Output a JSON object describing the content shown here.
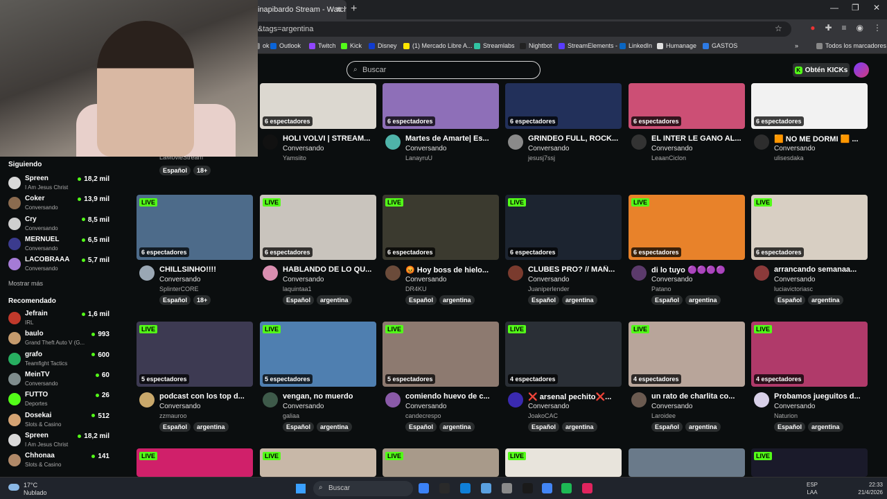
{
  "browser": {
    "tab_title": "inapibardo Stream - Watch Li",
    "tab_close": "✕",
    "new_tab": "+",
    "address": "&tags=argentina",
    "window_controls": [
      "—",
      "❐",
      "✕"
    ],
    "bookmarks": [
      {
        "label": "ok",
        "color": "#888888"
      },
      {
        "label": "Outlook",
        "color": "#0a64d8"
      },
      {
        "label": "Twitch",
        "color": "#9146ff"
      },
      {
        "label": "Kick",
        "color": "#53fc18"
      },
      {
        "label": "Disney",
        "color": "#113ccf"
      },
      {
        "label": "(1) Mercado Libre A...",
        "color": "#ffe600"
      },
      {
        "label": "Streamlabs",
        "color": "#31c3a2"
      },
      {
        "label": "Nightbot",
        "color": "#222222"
      },
      {
        "label": "StreamElements -",
        "color": "#5a3cff"
      },
      {
        "label": "LinkedIn",
        "color": "#0a66c2"
      },
      {
        "label": "Humanage",
        "color": "#e0e0e0"
      },
      {
        "label": "GASTOS",
        "color": "#2d7be5"
      },
      {
        "label": "»",
        "color": ""
      },
      {
        "label": "Todos los marcadores",
        "color": "#888888"
      }
    ]
  },
  "header": {
    "search_placeholder": "Buscar",
    "cta_label": "Obtén KICKs"
  },
  "sidebar": {
    "following_title": "Siguiendo",
    "following": [
      {
        "name": "Spreen",
        "sub": "I Am Jesus Christ",
        "count": "18,2 mil",
        "color": "#d9d9d9"
      },
      {
        "name": "Coker",
        "sub": "Conversando",
        "count": "13,9 mil",
        "color": "#8b6b4f"
      },
      {
        "name": "Cry",
        "sub": "Conversando",
        "count": "8,5 mil",
        "color": "#cfcfcf"
      },
      {
        "name": "MERNUEL",
        "sub": "Conversando",
        "count": "6,5 mil",
        "color": "#3b3b8e"
      },
      {
        "name": "LACOBRAAA",
        "sub": "Conversando",
        "count": "5,7 mil",
        "color": "#a57bd6"
      }
    ],
    "more_label": "Mostrar más",
    "recommended_title": "Recomendado",
    "recommended": [
      {
        "name": "Jefrain",
        "sub": "IRL",
        "count": "1,6 mil",
        "color": "#c0392b"
      },
      {
        "name": "baulo",
        "sub": "Grand Theft Auto V (G...",
        "count": "993",
        "color": "#c59b6d"
      },
      {
        "name": "grafo",
        "sub": "Teamfight Tactics",
        "count": "600",
        "color": "#27ae60"
      },
      {
        "name": "MeinTV",
        "sub": "Conversando",
        "count": "60",
        "color": "#7f8c8d"
      },
      {
        "name": "FUTTO",
        "sub": "Deportes",
        "count": "26",
        "color": "#53fc18"
      },
      {
        "name": "Dosekai",
        "sub": "Slots & Casino",
        "count": "512",
        "color": "#d4a373"
      },
      {
        "name": "Spreen",
        "sub": "I Am Jesus Christ",
        "count": "18,2 mil",
        "color": "#d9d9d9"
      },
      {
        "name": "Chhonaa",
        "sub": "Slots & Casino",
        "count": "141",
        "color": "#b08968"
      }
    ]
  },
  "cards": [
    {
      "title": "",
      "category": "",
      "user": "LaMovieStream",
      "viewers": "",
      "tags": [
        "Español",
        "18+"
      ],
      "live": "",
      "thumb": "#2b2b2b",
      "avatar": "#555555"
    },
    {
      "title": "HOLI VOLVI | STREAM...",
      "category": "Conversando",
      "user": "Yamsiito",
      "viewers": "6 espectadores",
      "tags": [],
      "live": "",
      "thumb": "#dcd8d0",
      "avatar": "#111111"
    },
    {
      "title": "Martes de Amarte| Es...",
      "category": "Conversando",
      "user": "LanayruU",
      "viewers": "6 espectadores",
      "tags": [],
      "live": "",
      "thumb": "#8e6fb8",
      "avatar": "#4fb3a9"
    },
    {
      "title": "GRINDEO FULL, ROCK...",
      "category": "Conversando",
      "user": "jesusj7ssj",
      "viewers": "6 espectadores",
      "tags": [],
      "live": "",
      "thumb": "#22305a",
      "avatar": "#8a8a8a"
    },
    {
      "title": "EL INTER LE GANO AL...",
      "category": "Conversando",
      "user": "LeaanCiclon",
      "viewers": "6 espectadores",
      "tags": [],
      "live": "",
      "thumb": "#cc4f75",
      "avatar": "#333333"
    },
    {
      "title": "🟧 NO ME DORMI 🟧 ...",
      "category": "Conversando",
      "user": "ulisesdaka",
      "viewers": "6 espectadores",
      "tags": [],
      "live": "",
      "thumb": "#f2f2f2",
      "avatar": "#2d2d2d"
    },
    {
      "title": "CHILLSINHO!!!!",
      "category": "Conversando",
      "user": "SplinterCORE",
      "viewers": "6 espectadores",
      "tags": [
        "Español",
        "18+"
      ],
      "live": "LIVE",
      "thumb": "#4d6b8a",
      "avatar": "#9aa7b4"
    },
    {
      "title": "HABLANDO DE LO QU...",
      "category": "Conversando",
      "user": "laquintaa1",
      "viewers": "6 espectadores",
      "tags": [
        "Español",
        "argentina"
      ],
      "live": "LIVE",
      "thumb": "#c9c4bd",
      "avatar": "#d98eb0"
    },
    {
      "title": "😡 Hoy boss de hielo...",
      "category": "Conversando",
      "user": "DR4KU",
      "viewers": "6 espectadores",
      "tags": [
        "Español",
        "argentina"
      ],
      "live": "LIVE",
      "thumb": "#3b3a2f",
      "avatar": "#6b4b3a"
    },
    {
      "title": "CLUBES PRO? // MAÑ...",
      "category": "Conversando",
      "user": "Juaniperlender",
      "viewers": "6 espectadores",
      "tags": [
        "Español",
        "argentina"
      ],
      "live": "LIVE",
      "thumb": "#1c2430",
      "avatar": "#7a3b2e"
    },
    {
      "title": "di lo tuyo 🟣🟣🟣🟣",
      "category": "Conversando",
      "user": "Patano",
      "viewers": "6 espectadores",
      "tags": [
        "Español",
        "argentina"
      ],
      "live": "LIVE",
      "thumb": "#e8822a",
      "avatar": "#5b3a6b"
    },
    {
      "title": "arrancando semanaa...",
      "category": "Conversando",
      "user": "luciavictoriasc",
      "viewers": "6 espectadores",
      "tags": [
        "Español",
        "argentina"
      ],
      "live": "LIVE",
      "thumb": "#d8cfc3",
      "avatar": "#8b3a3a"
    },
    {
      "title": "podcast con los top d...",
      "category": "Conversando",
      "user": "zzmauroo",
      "viewers": "5 espectadores",
      "tags": [
        "Español",
        "argentina"
      ],
      "live": "LIVE",
      "thumb": "#3d3a52",
      "avatar": "#c9a86b"
    },
    {
      "title": "vengan, no muerdo",
      "category": "Conversando",
      "user": "galiaa",
      "viewers": "5 espectadores",
      "tags": [
        "Español",
        "argentina"
      ],
      "live": "LIVE",
      "thumb": "#4f7fb0",
      "avatar": "#3e5a4a"
    },
    {
      "title": "comiendo huevo de c...",
      "category": "Conversando",
      "user": "candecrespo",
      "viewers": "5 espectadores",
      "tags": [
        "Español",
        "argentina"
      ],
      "live": "LIVE",
      "thumb": "#8d7a70",
      "avatar": "#8a5aa8"
    },
    {
      "title": "❌ arsenal pechito❌...",
      "category": "Conversando",
      "user": "JoakoCAC",
      "viewers": "4 espectadores",
      "tags": [
        "Español",
        "argentina"
      ],
      "live": "LIVE",
      "thumb": "#2a2f36",
      "avatar": "#3a2ab0"
    },
    {
      "title": "un rato de charlita co...",
      "category": "Conversando",
      "user": "Laroidee",
      "viewers": "4 espectadores",
      "tags": [
        "Español",
        "argentina"
      ],
      "live": "LIVE",
      "thumb": "#b8a59a",
      "avatar": "#6b5a50"
    },
    {
      "title": "Probamos jueguitos d...",
      "category": "Conversando",
      "user": "Naturion",
      "viewers": "4 espectadores",
      "tags": [
        "Español",
        "argentina"
      ],
      "live": "LIVE",
      "thumb": "#b03a6a",
      "avatar": "#d8d0e8"
    },
    {
      "title": "",
      "category": "",
      "user": "",
      "viewers": "",
      "tags": [],
      "live": "LIVE",
      "thumb": "#d0206a",
      "avatar": ""
    },
    {
      "title": "",
      "category": "",
      "user": "",
      "viewers": "",
      "tags": [],
      "live": "LIVE",
      "thumb": "#c8b8a8",
      "avatar": ""
    },
    {
      "title": "",
      "category": "",
      "user": "",
      "viewers": "",
      "tags": [],
      "live": "LIVE",
      "thumb": "#a89a8a",
      "avatar": ""
    },
    {
      "title": "",
      "category": "",
      "user": "",
      "viewers": "",
      "tags": [],
      "live": "LIVE",
      "thumb": "#e8e4dc",
      "avatar": ""
    },
    {
      "title": "",
      "category": "",
      "user": "",
      "viewers": "",
      "tags": [],
      "live": "",
      "thumb": "#6a7a8a",
      "avatar": ""
    },
    {
      "title": "",
      "category": "",
      "user": "",
      "viewers": "",
      "tags": [],
      "live": "LIVE",
      "thumb": "#1a1a2a",
      "avatar": ""
    }
  ],
  "taskbar": {
    "weather_temp": "17°C",
    "weather_text": "Nublado",
    "search_placeholder": "Buscar",
    "lang_top": "ESP",
    "lang_bottom": "LAA",
    "time": "22:33",
    "date": "21/4/2026",
    "apps": [
      "#3b82f6",
      "#2a2a2a",
      "#0f7fd8",
      "#5aa0e0",
      "#8a8a8a",
      "#1a1a1a",
      "#4285f4",
      "#1db954",
      "#e0245e"
    ]
  }
}
